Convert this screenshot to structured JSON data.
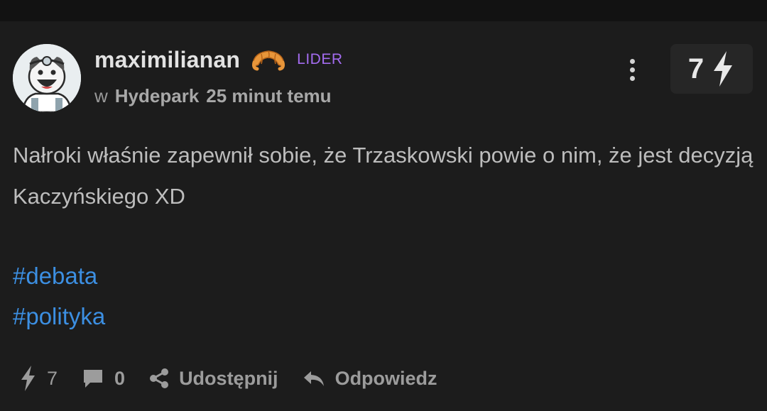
{
  "post": {
    "author": {
      "name": "maximilianan",
      "rank": "LIDER",
      "rank_color": "#a46cf0",
      "badge_icon": "croissant-icon"
    },
    "meta": {
      "prefix": "w",
      "community": "Hydepark",
      "time": "25 minut temu"
    },
    "vote_count": "7",
    "content": "Nałroki właśnie zapewnił sobie, że Trzaskowski powie o nim, że jest decyzją Kaczyńskiego XD",
    "tags": [
      "#debata",
      "#polityka"
    ],
    "footer": {
      "zap_count": "7",
      "comment_count": "0",
      "share_label": "Udostępnij",
      "reply_label": "Odpowiedz"
    }
  },
  "colors": {
    "background": "#1c1c1c",
    "tag": "#3c8fe2",
    "text": "#bdbdbd"
  }
}
